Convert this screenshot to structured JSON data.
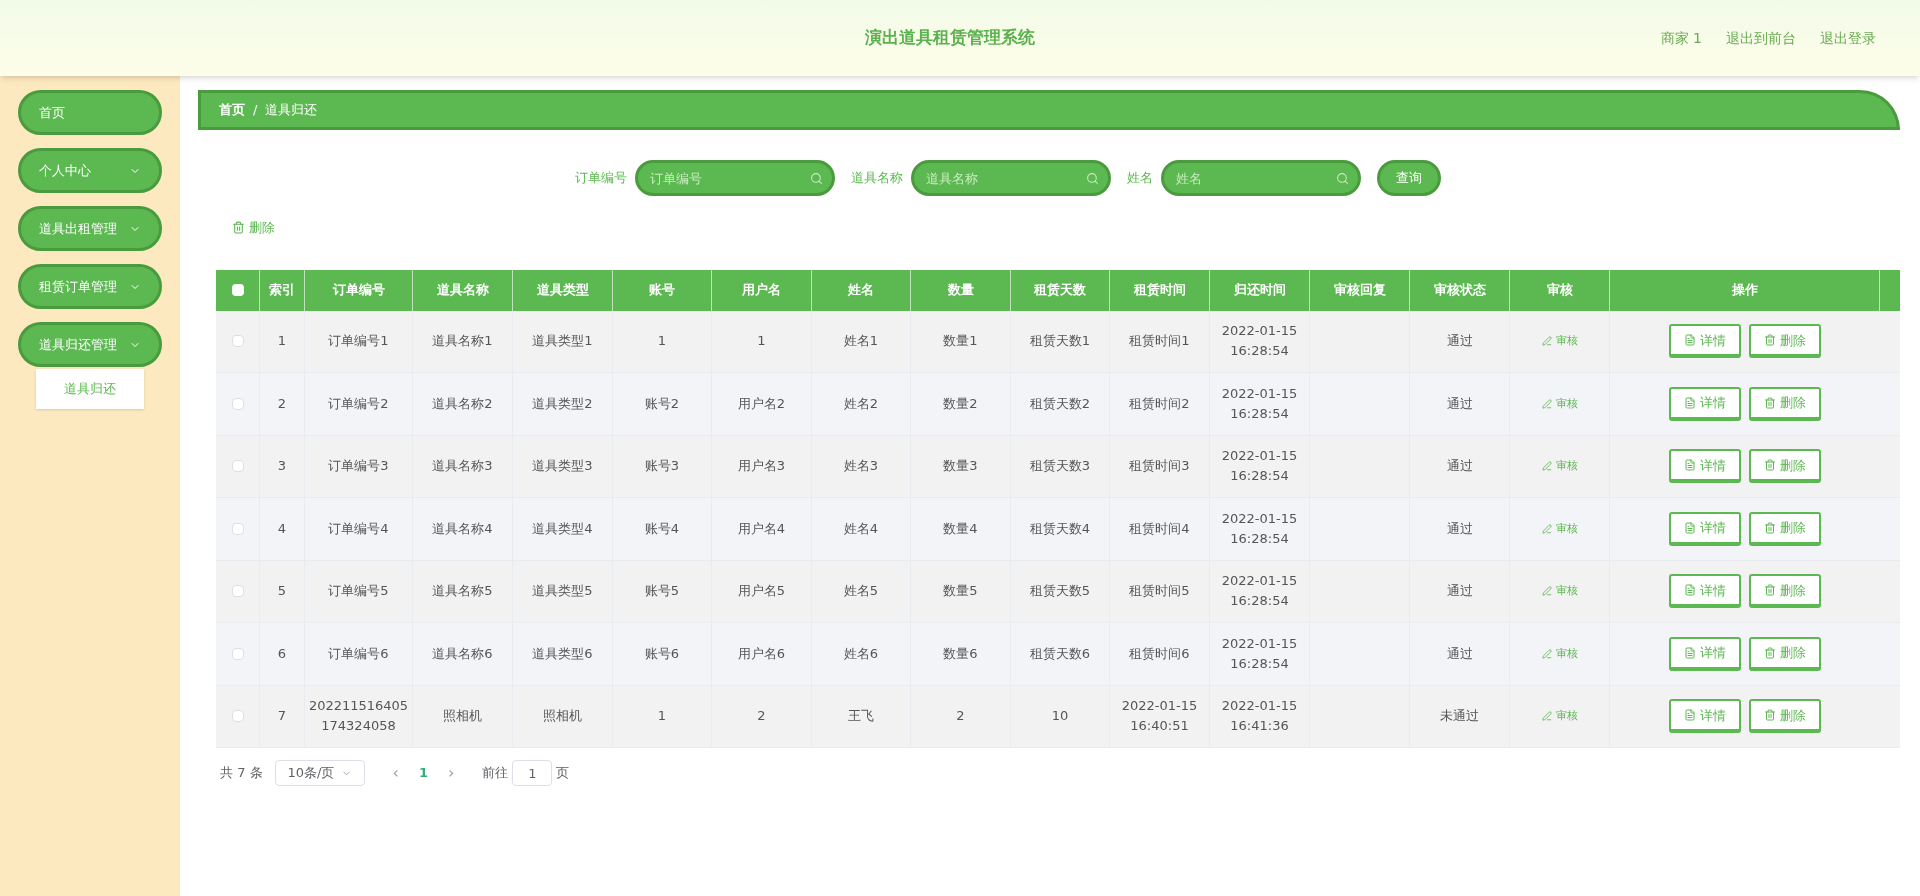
{
  "header": {
    "title": "演出道具租赁管理系统",
    "links": [
      "商家 1",
      "退出到前台",
      "退出登录"
    ]
  },
  "sidebar": {
    "items": [
      {
        "label": "首页",
        "kind": "link"
      },
      {
        "label": "个人中心",
        "kind": "group"
      },
      {
        "label": "道具出租管理",
        "kind": "group"
      },
      {
        "label": "租赁订单管理",
        "kind": "group"
      },
      {
        "label": "道具归还管理",
        "kind": "group",
        "children": [
          {
            "label": "道具归还",
            "selected": true
          }
        ]
      }
    ]
  },
  "breadcrumb": [
    "首页",
    "/",
    "道具归还"
  ],
  "search": {
    "fields": [
      {
        "label": "订单编号",
        "placeholder": "订单编号"
      },
      {
        "label": "道具名称",
        "placeholder": "道具名称"
      },
      {
        "label": "姓名",
        "placeholder": "姓名"
      }
    ],
    "button": "查询"
  },
  "toolbar": {
    "delete": "删除"
  },
  "table": {
    "all_checked": false,
    "columns": [
      "索引",
      "订单编号",
      "道具名称",
      "道具类型",
      "账号",
      "用户名",
      "姓名",
      "数量",
      "租赁天数",
      "租赁时间",
      "归还时间",
      "审核回复",
      "审核状态",
      "审核",
      "操作"
    ],
    "rows": [
      {
        "checked": false,
        "cells": [
          "1",
          "订单编号1",
          "道具名称1",
          "道具类型1",
          "1",
          "1",
          "姓名1",
          "数量1",
          "租赁天数1",
          "租赁时间1",
          "2022-01-15 16:28:54",
          "",
          "通过"
        ],
        "review": "审核",
        "actions": [
          "详情",
          "删除"
        ]
      },
      {
        "checked": false,
        "cells": [
          "2",
          "订单编号2",
          "道具名称2",
          "道具类型2",
          "账号2",
          "用户名2",
          "姓名2",
          "数量2",
          "租赁天数2",
          "租赁时间2",
          "2022-01-15 16:28:54",
          "",
          "通过"
        ],
        "review": "审核",
        "actions": [
          "详情",
          "删除"
        ]
      },
      {
        "checked": false,
        "cells": [
          "3",
          "订单编号3",
          "道具名称3",
          "道具类型3",
          "账号3",
          "用户名3",
          "姓名3",
          "数量3",
          "租赁天数3",
          "租赁时间3",
          "2022-01-15 16:28:54",
          "",
          "通过"
        ],
        "review": "审核",
        "actions": [
          "详情",
          "删除"
        ]
      },
      {
        "checked": false,
        "cells": [
          "4",
          "订单编号4",
          "道具名称4",
          "道具类型4",
          "账号4",
          "用户名4",
          "姓名4",
          "数量4",
          "租赁天数4",
          "租赁时间4",
          "2022-01-15 16:28:54",
          "",
          "通过"
        ],
        "review": "审核",
        "actions": [
          "详情",
          "删除"
        ]
      },
      {
        "checked": false,
        "cells": [
          "5",
          "订单编号5",
          "道具名称5",
          "道具类型5",
          "账号5",
          "用户名5",
          "姓名5",
          "数量5",
          "租赁天数5",
          "租赁时间5",
          "2022-01-15 16:28:54",
          "",
          "通过"
        ],
        "review": "审核",
        "actions": [
          "详情",
          "删除"
        ]
      },
      {
        "checked": false,
        "cells": [
          "6",
          "订单编号6",
          "道具名称6",
          "道具类型6",
          "账号6",
          "用户名6",
          "姓名6",
          "数量6",
          "租赁天数6",
          "租赁时间6",
          "2022-01-15 16:28:54",
          "",
          "通过"
        ],
        "review": "审核",
        "actions": [
          "详情",
          "删除"
        ]
      },
      {
        "checked": false,
        "cells": [
          "7",
          "202211516405 174324058",
          "照相机",
          "照相机",
          "1",
          "2",
          "王飞",
          "2",
          "10",
          "2022-01-15 16:40:51",
          "2022-01-15 16:41:36",
          "",
          "未通过"
        ],
        "review": "审核",
        "actions": [
          "详情",
          "删除"
        ]
      }
    ]
  },
  "pagination": {
    "total": "共 7 条",
    "page_size": "10条/页",
    "prev": "‹",
    "pages": [
      {
        "label": "1",
        "selected": true
      }
    ],
    "next": "›",
    "goto_label": "前往",
    "goto_value": "1",
    "goto_suffix": "页"
  }
}
